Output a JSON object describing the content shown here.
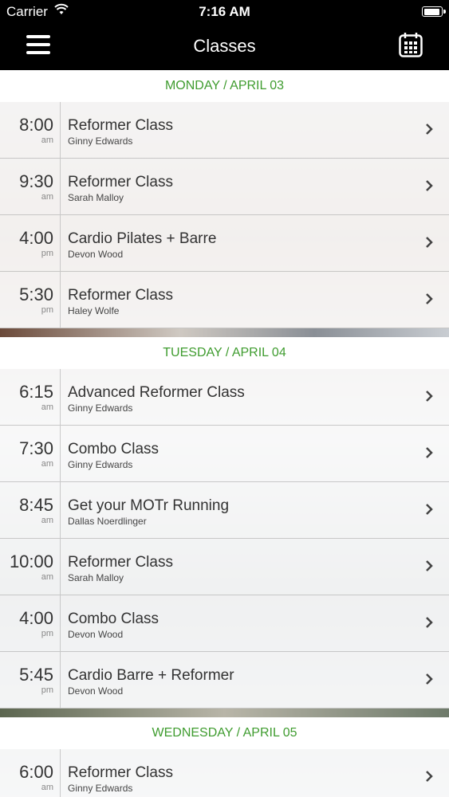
{
  "status": {
    "carrier": "Carrier",
    "time": "7:16 AM"
  },
  "nav": {
    "title": "Classes"
  },
  "colors": {
    "header_text": "#3f9c2f",
    "bar": "#000000"
  },
  "days": [
    {
      "label": "MONDAY / APRIL 03",
      "classes": [
        {
          "time": "8:00",
          "ampm": "am",
          "name": "Reformer Class",
          "instructor": "Ginny Edwards"
        },
        {
          "time": "9:30",
          "ampm": "am",
          "name": "Reformer Class",
          "instructor": "Sarah Malloy"
        },
        {
          "time": "4:00",
          "ampm": "pm",
          "name": "Cardio Pilates + Barre",
          "instructor": "Devon Wood"
        },
        {
          "time": "5:30",
          "ampm": "pm",
          "name": "Reformer Class",
          "instructor": "Haley Wolfe"
        }
      ]
    },
    {
      "label": "TUESDAY / APRIL 04",
      "classes": [
        {
          "time": "6:15",
          "ampm": "am",
          "name": "Advanced Reformer Class",
          "instructor": "Ginny Edwards"
        },
        {
          "time": "7:30",
          "ampm": "am",
          "name": "Combo Class",
          "instructor": "Ginny Edwards"
        },
        {
          "time": "8:45",
          "ampm": "am",
          "name": "Get your MOTr Running",
          "instructor": "Dallas Noerdlinger"
        },
        {
          "time": "10:00",
          "ampm": "am",
          "name": "Reformer Class",
          "instructor": "Sarah Malloy"
        },
        {
          "time": "4:00",
          "ampm": "pm",
          "name": "Combo Class",
          "instructor": "Devon Wood"
        },
        {
          "time": "5:45",
          "ampm": "pm",
          "name": "Cardio Barre + Reformer",
          "instructor": "Devon Wood"
        }
      ]
    },
    {
      "label": "WEDNESDAY / APRIL 05",
      "classes": [
        {
          "time": "6:00",
          "ampm": "am",
          "name": "Reformer Class",
          "instructor": "Ginny Edwards"
        }
      ]
    }
  ]
}
